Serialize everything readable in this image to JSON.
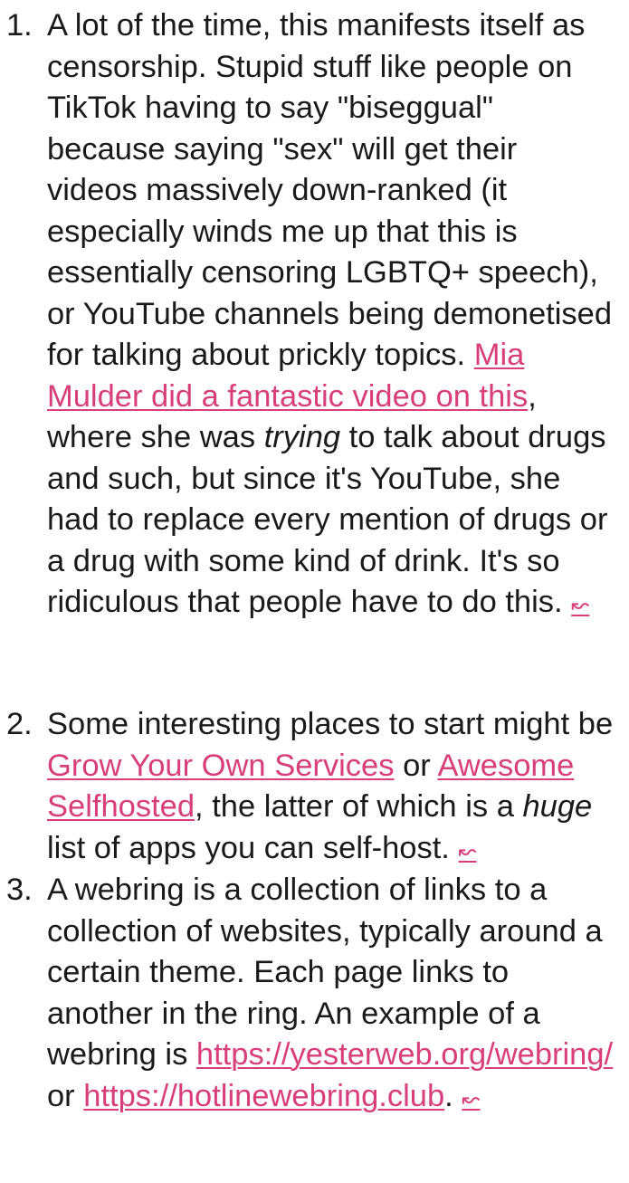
{
  "footnotes": [
    {
      "number": "1.",
      "text_a": "A lot of the time, this manifests itself as censorship. Stupid stuff like people on TikTok having to say \"biseggual\" because saying \"sex\" will get their videos massively down-ranked (it especially winds me up that this is essentially censoring LGBTQ+ speech), or YouTube channels being demonetised for talking about prickly topics. ",
      "link": "Mia Mulder did a fantastic video on this",
      "text_b": ", where she was ",
      "emphasis": "trying",
      "text_c": " to talk about drugs and such, but since it's YouTube, she had to replace every mention of drugs or a drug with some kind of drink. It's so ridiculous that people have to do this. ",
      "backref": "↜"
    },
    {
      "number": "2.",
      "text_a": "Some interesting places to start might be ",
      "link_1": "Grow Your Own Services",
      "text_b": " or ",
      "link_2": "Awesome Selfhosted",
      "text_c": ", the latter of which is a ",
      "emphasis": "huge",
      "text_d": " list of apps you can self-host. ",
      "backref": "↜"
    },
    {
      "number": "3.",
      "text_a": "A webring is a collection of links to a collection of websites, typically around a certain theme. Each page links to another in the ring. An example of a webring is ",
      "link_1": "https://yesterweb.org/webring/",
      "text_b": " or ",
      "link_2": "https://hotlinewebring.club",
      "text_c": ". ",
      "backref": "↜"
    }
  ],
  "colors": {
    "text": "#1a1a1a",
    "link": "#d83f7a",
    "background": "#ffffff"
  }
}
